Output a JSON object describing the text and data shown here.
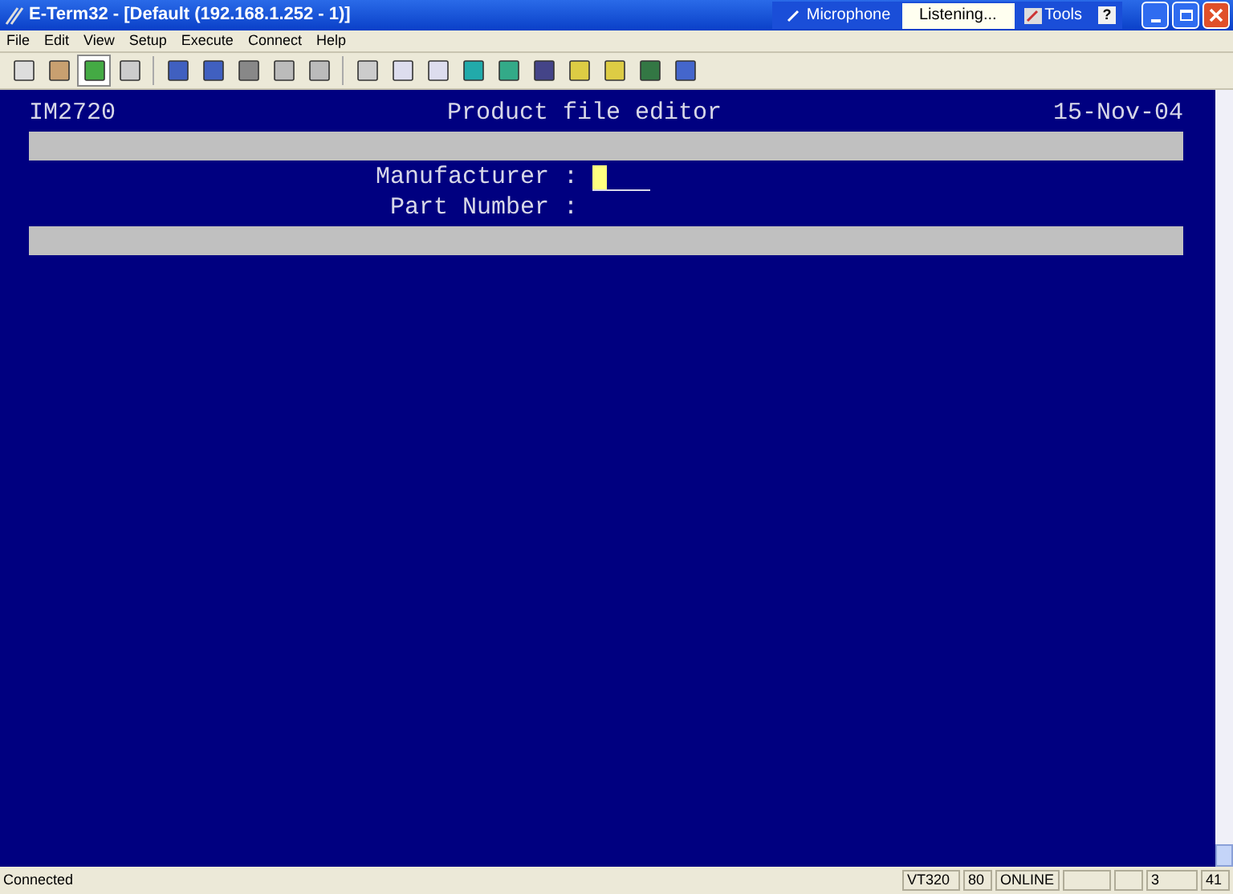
{
  "window": {
    "title": "E-Term32 - [Default (192.168.1.252 - 1)]"
  },
  "language_bar": {
    "microphone": "Microphone",
    "status": "Listening...",
    "tools": "Tools",
    "help": "?"
  },
  "menu": [
    "File",
    "Edit",
    "View",
    "Setup",
    "Execute",
    "Connect",
    "Help"
  ],
  "terminal": {
    "program_code": "IM2720",
    "screen_title": "Product file editor",
    "date": "15-Nov-04",
    "fields": [
      {
        "label": "Manufacturer :",
        "focused": true
      },
      {
        "label": "Part Number :",
        "focused": false
      }
    ]
  },
  "status_bar": {
    "message": "Connected",
    "panels": [
      "VT320",
      "80",
      "ONLINE",
      "3",
      "41"
    ]
  }
}
